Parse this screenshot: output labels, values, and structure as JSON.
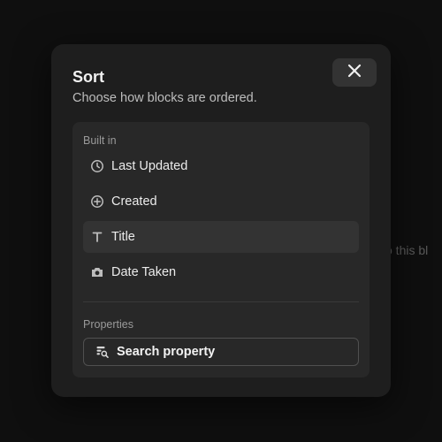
{
  "background": {
    "text_fragment": "o this bl"
  },
  "modal": {
    "title": "Sort",
    "subtitle": "Choose how blocks are ordered.",
    "close_icon": "close-icon"
  },
  "built_in": {
    "label": "Built in",
    "items": [
      {
        "label": "Last Updated",
        "icon": "clock-icon",
        "active": false
      },
      {
        "label": "Created",
        "icon": "plus-circle-icon",
        "active": false
      },
      {
        "label": "Title",
        "icon": "text-t-icon",
        "active": true
      },
      {
        "label": "Date Taken",
        "icon": "camera-icon",
        "active": false
      }
    ]
  },
  "properties": {
    "label": "Properties",
    "search_label": "Search property",
    "search_icon": "search-property-icon"
  },
  "colors": {
    "page_bg": "#0f0f0f",
    "modal_bg": "#1e1e1e",
    "panel_bg": "#282828",
    "active_bg": "#333333",
    "text_primary": "#ececec",
    "text_muted": "#9a9a9a"
  }
}
